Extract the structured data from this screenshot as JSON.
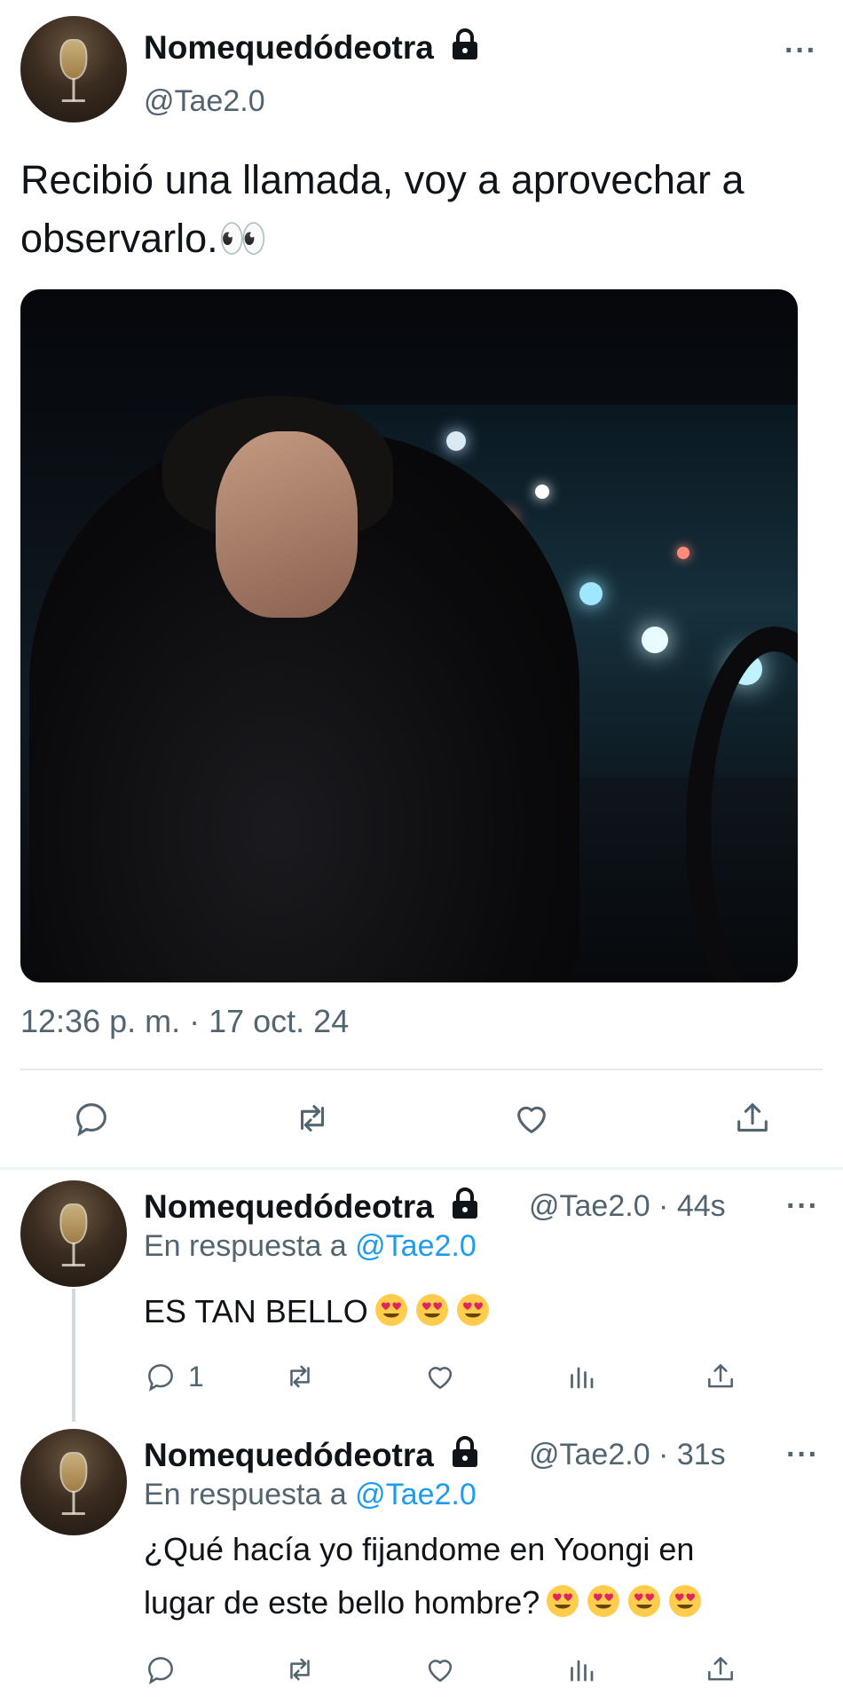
{
  "main_tweet": {
    "author": {
      "name": "Nomequedódeotra",
      "handle": "@Tae2.0",
      "protected": true
    },
    "text": "Recibió una llamada, voy a aprovechar a observarlo.👀",
    "timestamp": "12:36 p. m. · 17 oct. 24",
    "more_label": "···",
    "actions": [
      "reply-icon",
      "retweet-icon",
      "like-icon",
      "share-icon"
    ]
  },
  "replies": [
    {
      "name": "Nomequedódeotra",
      "handle_time": "@Tae2.0 · 44s",
      "reply_prefix": "En respuesta a",
      "reply_mention": "@Tae2.0",
      "text": "ES TAN BELLO",
      "emoji": [
        "heart-eyes",
        "heart-eyes",
        "heart-eyes"
      ],
      "reply_count": "1",
      "more_label": "···"
    },
    {
      "name": "Nomequedódeotra",
      "handle_time": "@Tae2.0 · 31s",
      "reply_prefix": "En respuesta a",
      "reply_mention": "@Tae2.0",
      "text_line1": "¿Qué hacía yo fijandome en Yoongi en",
      "text_line2": "lugar de este bello hombre?",
      "emoji": [
        "heart-eyes",
        "heart-eyes",
        "heart-eyes",
        "heart-eyes"
      ],
      "reply_count": "",
      "more_label": "···"
    }
  ],
  "colors": {
    "text": "#0f1419",
    "secondary": "#536471",
    "link": "#1d9bf0",
    "divider": "#e7e9ec"
  }
}
